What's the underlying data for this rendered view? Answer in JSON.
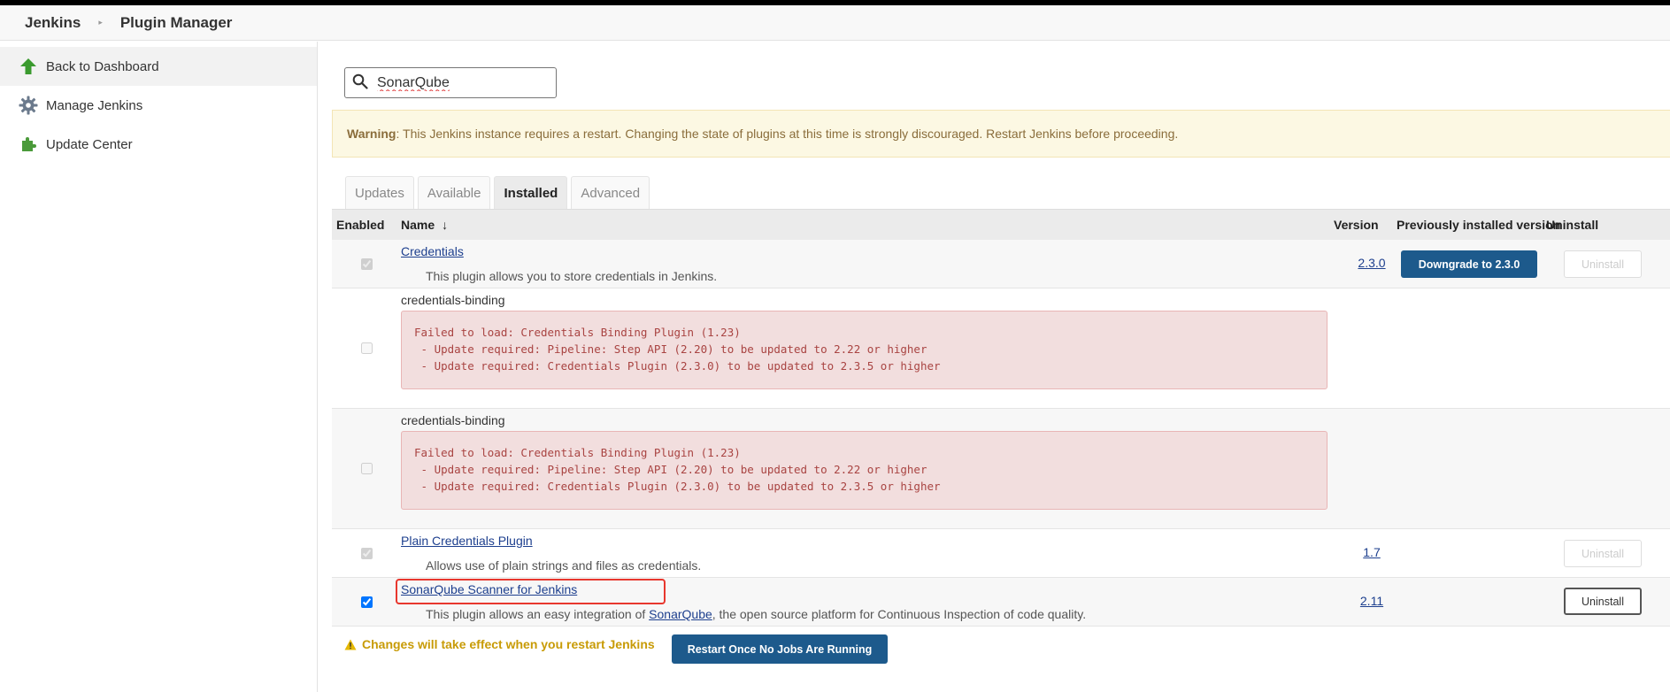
{
  "breadcrumb": {
    "items": [
      "Jenkins",
      "Plugin Manager"
    ]
  },
  "sidebar": {
    "items": [
      {
        "label": "Back to Dashboard",
        "icon": "up-arrow-icon"
      },
      {
        "label": "Manage Jenkins",
        "icon": "gear-icon"
      },
      {
        "label": "Update Center",
        "icon": "puzzle-icon"
      }
    ]
  },
  "search": {
    "value": "SonarQube"
  },
  "warning": {
    "label": "Warning",
    "text": ": This Jenkins instance requires a restart. Changing the state of plugins at this time is strongly discouraged. Restart Jenkins before proceeding."
  },
  "tabs": [
    "Updates",
    "Available",
    "Installed",
    "Advanced"
  ],
  "active_tab": "Installed",
  "table": {
    "headers": {
      "enabled": "Enabled",
      "name": "Name",
      "sort_indicator": "↓",
      "version": "Version",
      "previous": "Previously installed version",
      "uninstall": "Uninstall"
    },
    "rows": [
      {
        "name": "Credentials",
        "description": "This plugin allows you to store credentials in Jenkins.",
        "version": "2.3.0",
        "downgrade": "Downgrade to 2.3.0",
        "uninstall": "Uninstall",
        "enabled": true,
        "uninstall_enabled": false
      },
      {
        "name": "credentials-binding",
        "error": "Failed to load: Credentials Binding Plugin (1.23)\n - Update required: Pipeline: Step API (2.20) to be updated to 2.22 or higher\n - Update required: Credentials Plugin (2.3.0) to be updated to 2.3.5 or higher",
        "enabled": false
      },
      {
        "name": "credentials-binding",
        "error": "Failed to load: Credentials Binding Plugin (1.23)\n - Update required: Pipeline: Step API (2.20) to be updated to 2.22 or higher\n - Update required: Credentials Plugin (2.3.0) to be updated to 2.3.5 or higher",
        "enabled": false
      },
      {
        "name": "Plain Credentials Plugin",
        "description": "Allows use of plain strings and files as credentials.",
        "version": "1.7",
        "uninstall": "Uninstall",
        "enabled": true,
        "uninstall_enabled": false
      },
      {
        "name": "SonarQube Scanner for Jenkins",
        "description_pre": "This plugin allows an easy integration of ",
        "description_link": "SonarQube",
        "description_post": ", the open source platform for Continuous Inspection of code quality.",
        "version": "2.11",
        "uninstall": "Uninstall",
        "enabled": true,
        "uninstall_enabled": true
      }
    ]
  },
  "footer": {
    "note": "Changes will take effect when you restart Jenkins",
    "restart_button": "Restart Once No Jobs Are Running"
  },
  "colors": {
    "accent_button": "#1d5a8c",
    "link": "#1d3f8e",
    "warning_bg": "#fcf8e3",
    "error_bg": "#f2dede",
    "highlight_box": "#e8372e"
  }
}
